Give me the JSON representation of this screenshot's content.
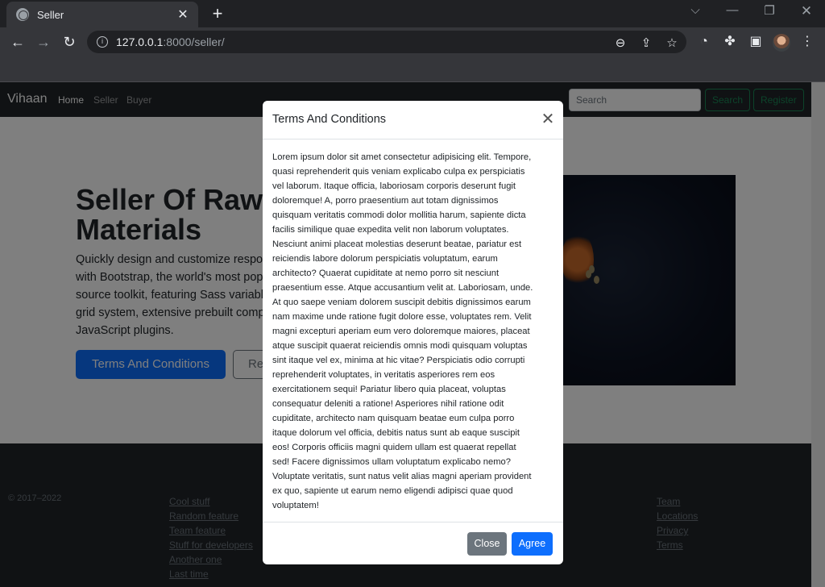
{
  "browser": {
    "tab_title": "Seller",
    "url_host": "127.0.0.1",
    "url_path": ":8000/seller/"
  },
  "site": {
    "brand": "Vihaan",
    "nav": [
      "Home",
      "Seller",
      "Buyer"
    ],
    "search_placeholder": "Search",
    "search_button": "Search",
    "register_button": "Register"
  },
  "hero": {
    "title_line1": "Seller Of Raw",
    "title_line2": "Materials",
    "lead_lines": [
      "Quickly design and customize respon",
      "with Bootstrap, the world's most popu",
      "source toolkit, featuring Sass variable",
      "grid system, extensive prebuilt compo",
      "JavaScript plugins."
    ],
    "primary_button": "Terms And Conditions",
    "secondary_button": "Re"
  },
  "footer": {
    "copyright": "© 2017–2022",
    "col1": [
      "Cool stuff",
      "Random feature",
      "Team feature",
      "Stuff for developers",
      "Another one",
      "Last time"
    ],
    "col2": [
      "Team",
      "Locations",
      "Privacy",
      "Terms"
    ]
  },
  "modal": {
    "title": "Terms And Conditions",
    "body_lines": [
      "Lorem ipsum dolor sit amet consectetur adipisicing elit. Tempore,",
      "quasi reprehenderit quis veniam explicabo culpa ex perspiciatis",
      "vel laborum. Itaque officia, laboriosam corporis deserunt fugit",
      "doloremque! A, porro praesentium aut totam dignissimos",
      "quisquam veritatis commodi dolor mollitia harum, sapiente dicta",
      "facilis similique quae expedita velit non laborum voluptates.",
      "Nesciunt animi placeat molestias deserunt beatae, pariatur est",
      "reiciendis labore dolorum perspiciatis voluptatum, earum",
      "architecto? Quaerat cupiditate at nemo porro sit nesciunt",
      "praesentium esse. Atque accusantium velit at. Laboriosam, unde.",
      "At quo saepe veniam dolorem suscipit debitis dignissimos earum",
      "nam maxime unde ratione fugit dolore esse, voluptates rem. Velit",
      "magni excepturi aperiam eum vero doloremque maiores, placeat",
      "atque suscipit quaerat reiciendis omnis modi quisquam voluptas",
      "sint itaque vel ex, minima at hic vitae? Perspiciatis odio corrupti",
      "reprehenderit voluptates, in veritatis asperiores rem eos",
      "exercitationem sequi! Pariatur libero quia placeat, voluptas",
      "consequatur deleniti a ratione! Asperiores nihil ratione odit",
      "cupiditate, architecto nam quisquam beatae eum culpa porro",
      "itaque dolorum vel officia, debitis natus sunt ab eaque suscipit",
      "eos! Corporis officiis magni quidem ullam est quaerat repellat",
      "sed! Facere dignissimos ullam voluptatum explicabo nemo?",
      "Voluptate veritatis, sunt natus velit alias magni aperiam provident",
      "ex quo, sapiente ut earum nemo eligendi adipisci quae quod",
      "voluptatem!"
    ],
    "close_button": "Close",
    "agree_button": "Agree"
  },
  "colors": {
    "primary": "#0d6efd",
    "secondary": "#6c757d",
    "success": "#198754",
    "dark": "#212529"
  }
}
